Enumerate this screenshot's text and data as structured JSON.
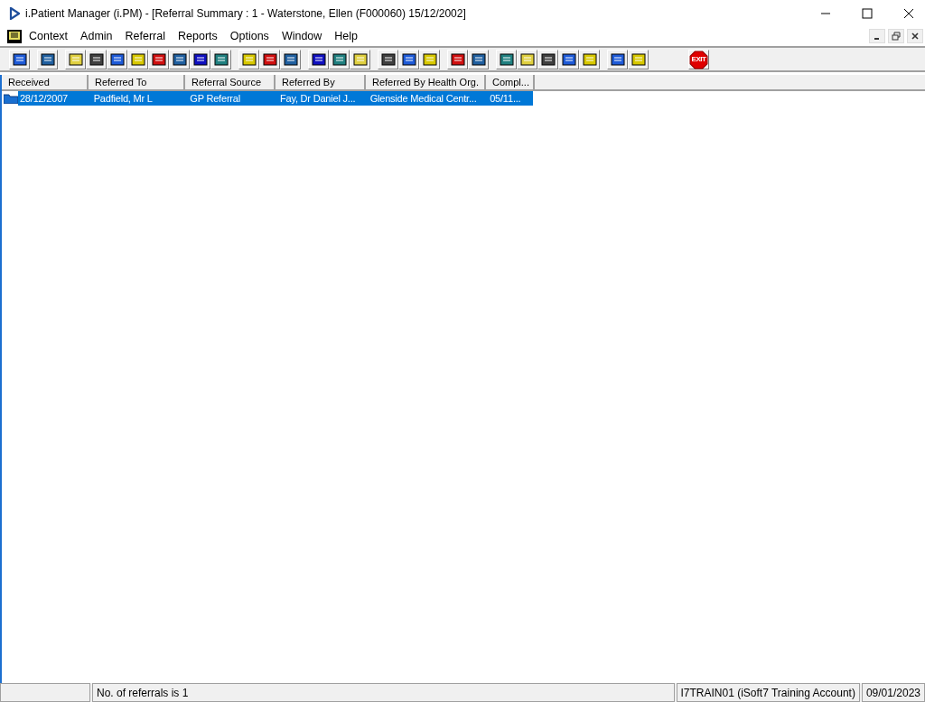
{
  "window": {
    "title": "i.Patient Manager (i.PM) - [Referral Summary : 1 - Waterstone, Ellen (F000060) 15/12/2002]"
  },
  "menu": [
    "Context",
    "Admin",
    "Referral",
    "Reports",
    "Options",
    "Window",
    "Help"
  ],
  "toolbar": {
    "exit_label": "EXIT"
  },
  "table": {
    "columns": [
      "Received",
      "Referred To",
      "Referral Source",
      "Referred By",
      "Referred By Health Org.",
      "Compl..."
    ],
    "rows": [
      {
        "selected": true,
        "cells": [
          "28/12/2007",
          "Padfield, Mr L",
          "GP Referral",
          "Fay, Dr Daniel J...",
          "Glenside Medical Centr...",
          "05/11..."
        ]
      }
    ]
  },
  "status_bar": [
    "No. of referrals is 1",
    "I7TRAIN01 (iSoft7 Training Account)",
    "09/01/2023"
  ]
}
